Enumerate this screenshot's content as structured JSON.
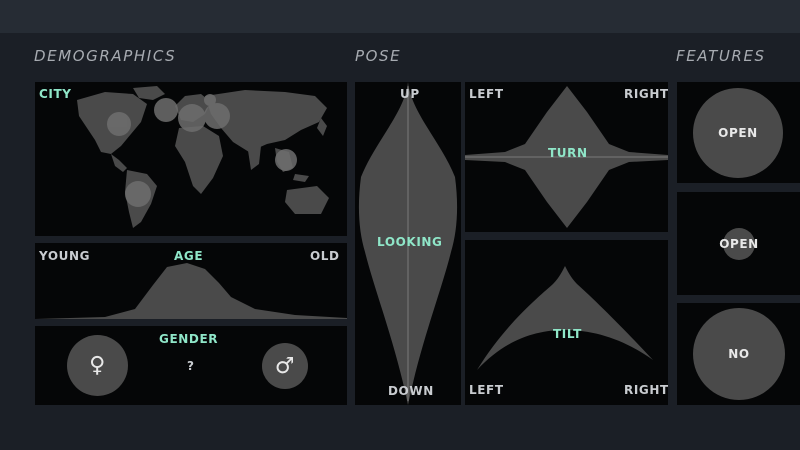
{
  "sections": {
    "demographics": "DEMOGRAPHICS",
    "pose": "POSE",
    "features": "FEATURES"
  },
  "demographics": {
    "city": {
      "label": "CITY"
    },
    "age": {
      "label": "AGE",
      "left": "YOUNG",
      "right": "OLD"
    },
    "gender": {
      "label": "GENDER",
      "female_icon": "female-symbol",
      "male_icon": "male-symbol",
      "unknown": "?"
    }
  },
  "pose": {
    "looking": {
      "label": "LOOKING",
      "top": "UP",
      "bottom": "DOWN"
    },
    "turn": {
      "label": "TURN",
      "left": "LEFT",
      "right": "RIGHT"
    },
    "tilt": {
      "label": "TILT",
      "left": "LEFT",
      "right": "RIGHT"
    }
  },
  "features": {
    "items": [
      {
        "label": "OPEN"
      },
      {
        "label": "OPEN"
      },
      {
        "label": "NO"
      }
    ]
  },
  "colors": {
    "background": "#1b1f26",
    "panel": "#050607",
    "shape": "#4a4a4a",
    "accent": "#8fe6c8",
    "text": "#c9ccd0"
  }
}
